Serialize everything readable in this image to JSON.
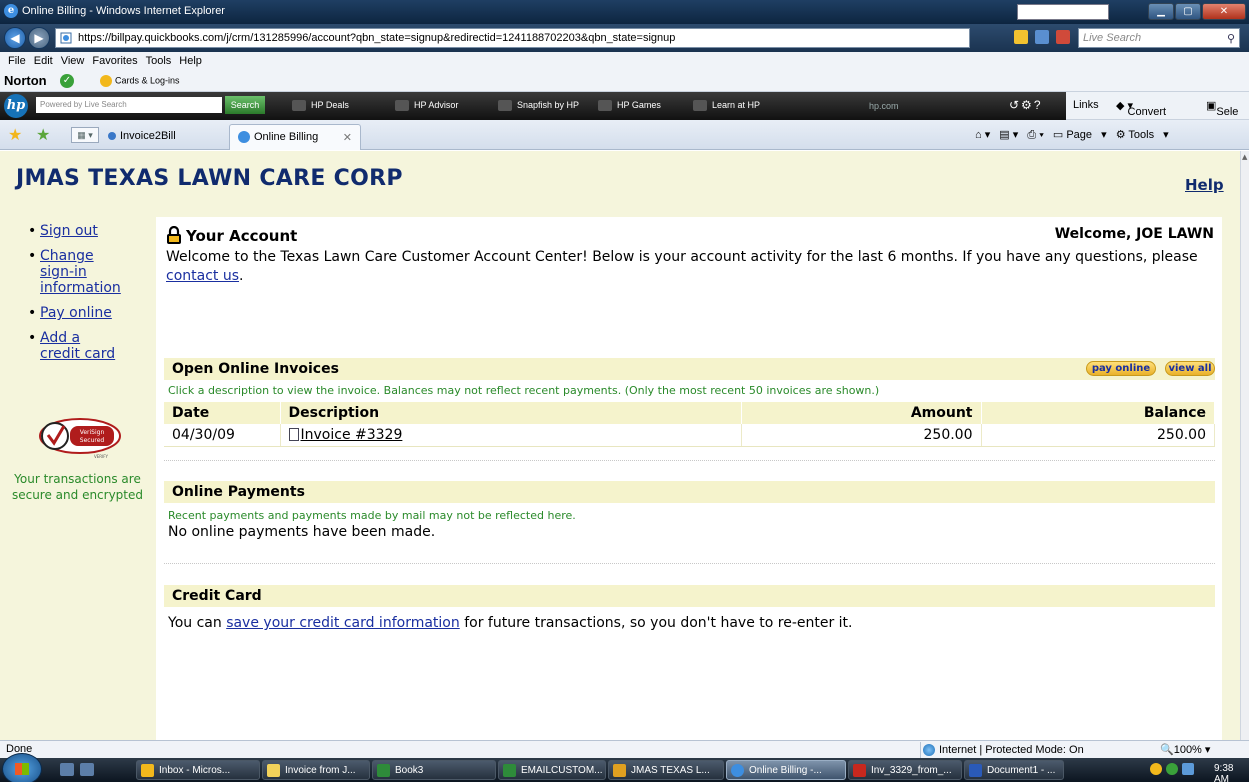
{
  "window": {
    "title": "Online Billing - Windows Internet Explorer"
  },
  "addressbar": {
    "url": "https://billpay.quickbooks.com/j/crm/131285996/account?qbn_state=signup&redirectid=1241188702203&qbn_state=signup",
    "search_placeholder": "Live Search"
  },
  "menubar": {
    "items": [
      "File",
      "Edit",
      "View",
      "Favorites",
      "Tools",
      "Help"
    ]
  },
  "norton": {
    "brand": "Norton",
    "cards_label": "Cards & Log-ins"
  },
  "hpbar": {
    "search_placeholder": "Powered by Live Search",
    "search_button": "Search",
    "links": [
      "HP Deals",
      "HP Advisor",
      "Snapfish by HP",
      "HP Games",
      "Learn at HP"
    ],
    "domain": "hp.com"
  },
  "ie_links": {
    "links_label": "Links",
    "convert_label": "Convert",
    "select_label": "Sele"
  },
  "tabs": [
    {
      "label": "Invoice2Bill"
    },
    {
      "label": "Online Billing"
    }
  ],
  "commandbar": {
    "page_label": "Page",
    "tools_label": "Tools"
  },
  "page": {
    "company": "JMAS TEXAS LAWN CARE CORP",
    "help": "Help",
    "leftnav": {
      "sign_out": "Sign out",
      "change_line1": "Change",
      "change_line2": "sign-in",
      "change_line3": "information",
      "pay_online": "Pay online",
      "add_line1": "Add a",
      "add_line2": "credit card"
    },
    "verisign": {
      "line1": "VeriSign",
      "line2": "Secured",
      "line3": "VERIFY"
    },
    "secure_text": "Your transactions are secure and encrypted",
    "account": {
      "heading": "Your Account",
      "welcome": "Welcome, JOE LAWN",
      "intro_text": "Welcome to the Texas Lawn Care Customer Account Center! Below is your account activity for the last 6 months. If you have any questions, please",
      "contact_link": "contact us",
      "intro_end": "."
    },
    "invoices": {
      "title": "Open Online Invoices",
      "pay_online_button": "pay online",
      "view_all_button": "view all",
      "note": "Click a description to view the invoice. Balances may not reflect recent payments. (Only the most recent 50 invoices are shown.)",
      "columns": {
        "date": "Date",
        "description": "Description",
        "amount": "Amount",
        "balance": "Balance"
      },
      "rows": [
        {
          "date": "04/30/09",
          "description": "Invoice #3329",
          "amount": "250.00",
          "balance": "250.00"
        }
      ]
    },
    "payments": {
      "title": "Online Payments",
      "note": "Recent payments and payments made by mail may not be reflected here.",
      "message": "No online payments have been made."
    },
    "credit_card": {
      "title": "Credit Card",
      "text_before": "You can",
      "link": "save your credit card information",
      "text_after": "for future transactions, so you don't have to re-enter it."
    }
  },
  "statusbar": {
    "status": "Done",
    "zone": "Internet | Protected Mode: On",
    "zoom": "100%"
  },
  "taskbar": {
    "buttons": [
      "Inbox - Micros...",
      "Invoice from J...",
      "Book3",
      "EMAILCUSTOM...",
      "JMAS TEXAS L...",
      "Online Billing -...",
      "Inv_3329_from_...",
      "Document1 - ..."
    ],
    "clock": "9:38 AM"
  },
  "colors": {
    "brand_navy": "#102b6e",
    "link_blue": "#1a2fa0",
    "note_green": "#2a8a2a",
    "page_bg": "#f5f5dc",
    "section_bg": "#f5f3cc"
  }
}
